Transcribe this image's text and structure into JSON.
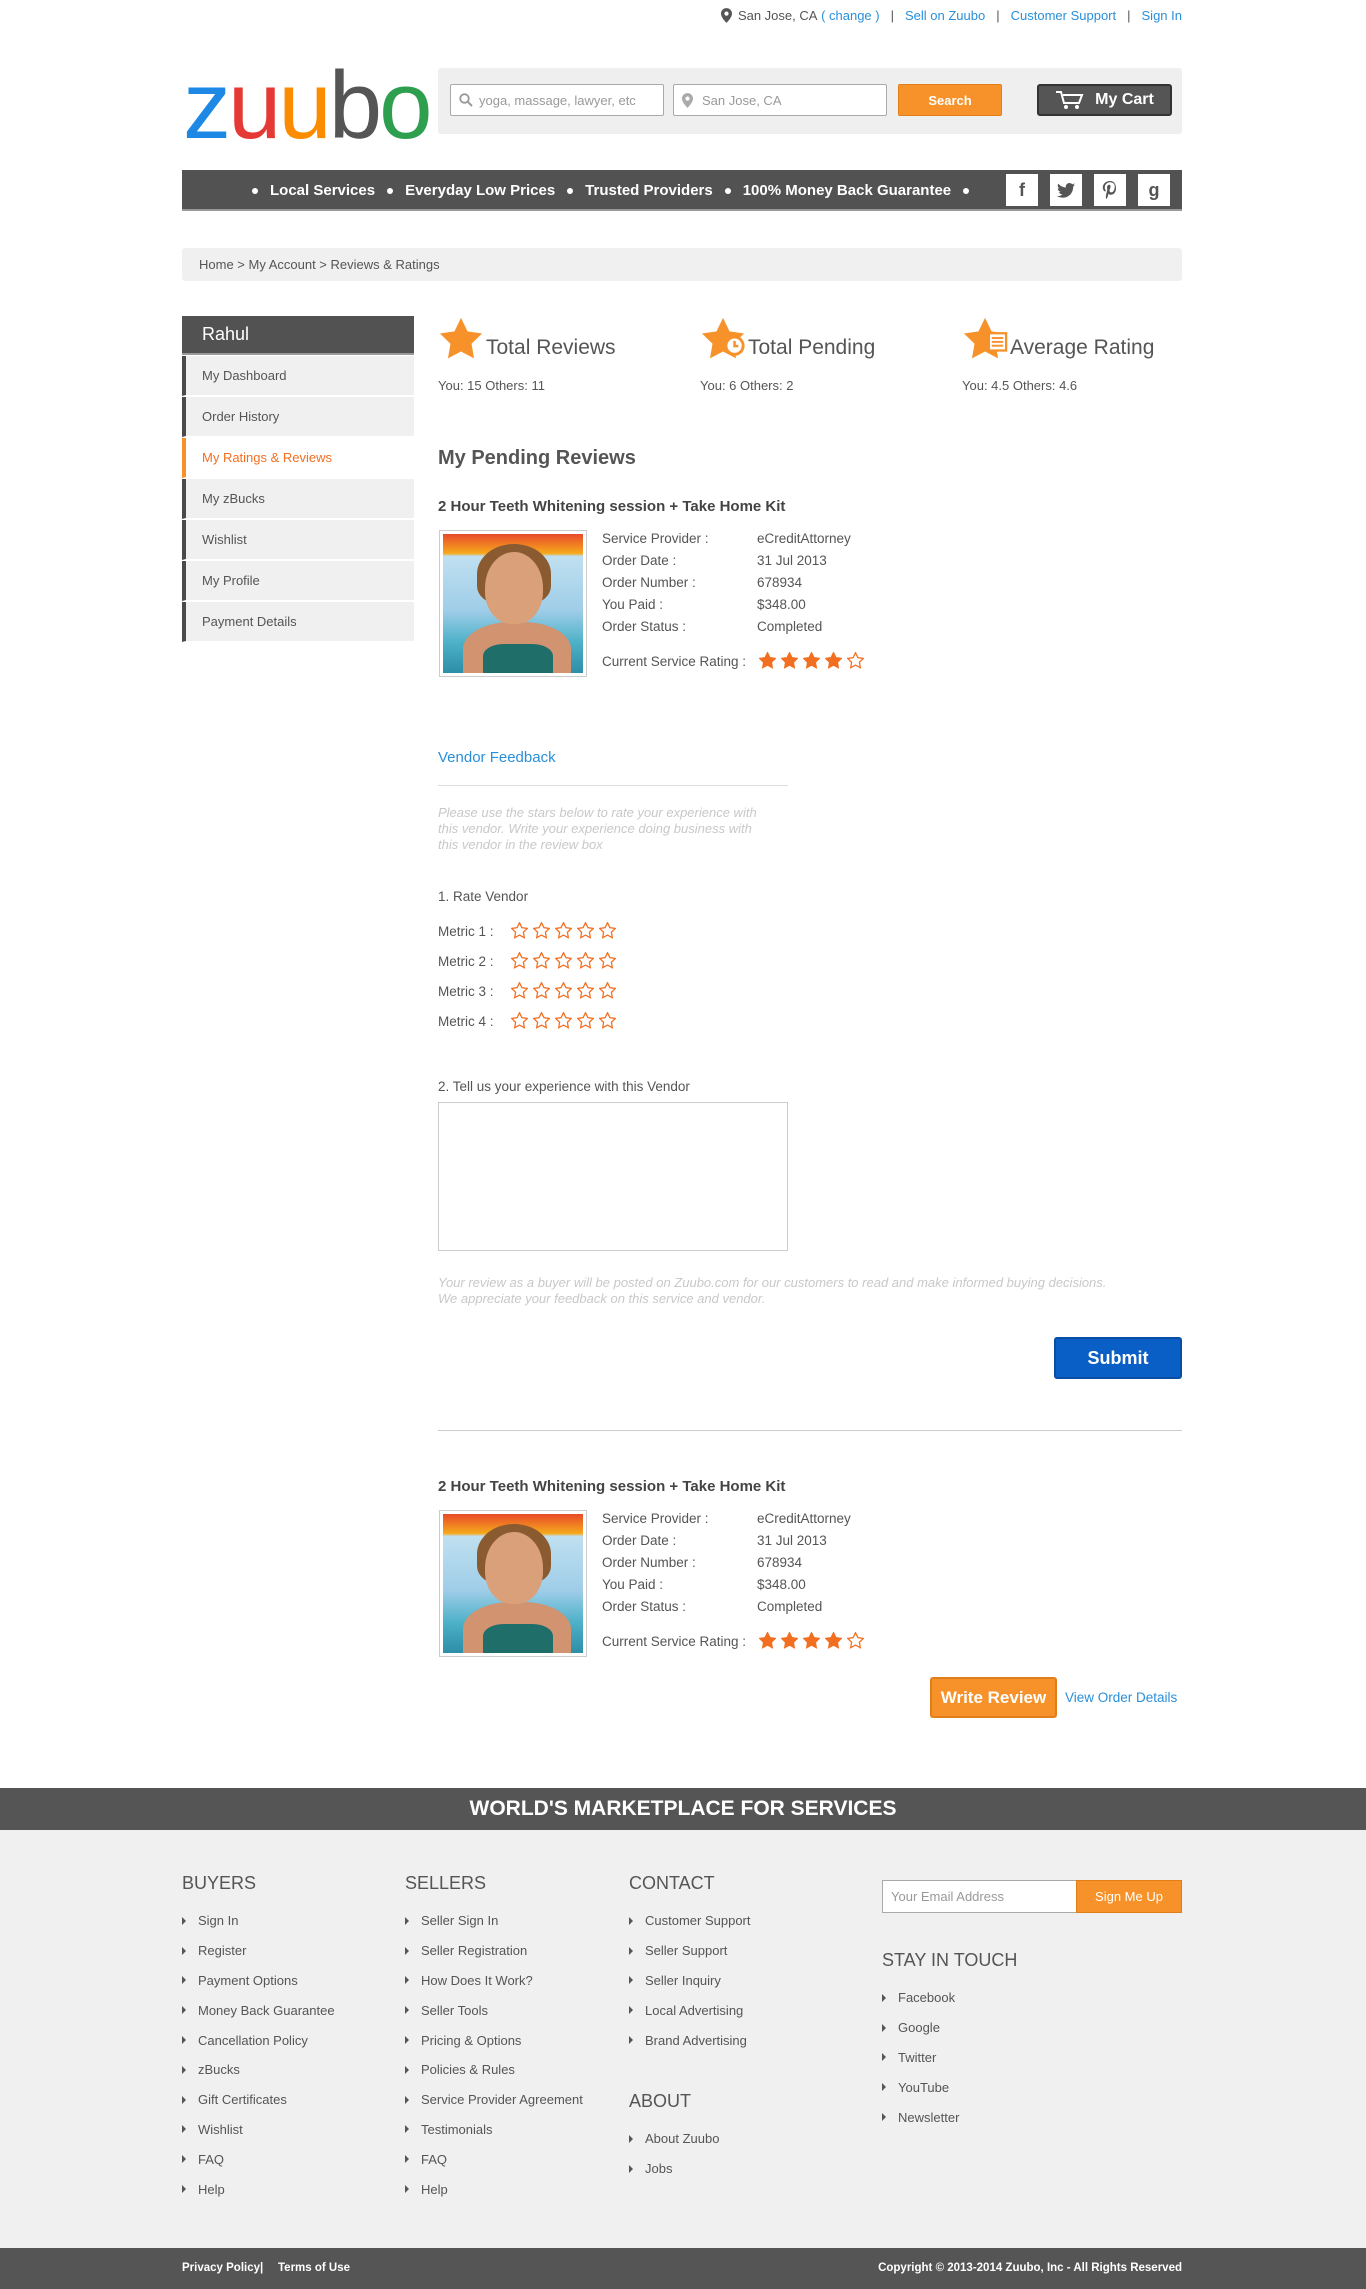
{
  "topbar": {
    "location": "San Jose, CA",
    "change": "( change )",
    "links": [
      "Sell on Zuubo",
      "Customer Support",
      "Sign In"
    ]
  },
  "brand": {
    "logo_letters": [
      "z",
      "u",
      "u",
      "b",
      "o"
    ],
    "logo_colors": [
      "#1e88e5",
      "#e53935",
      "#fb8c00",
      "#555555",
      "#2e9e4f"
    ]
  },
  "search": {
    "query_placeholder": "yoga, massage, lawyer, etc",
    "location_placeholder": "San Jose, CA",
    "search_label": "Search",
    "cart_label": "My Cart"
  },
  "nav": {
    "items": [
      "Local Services",
      "Everyday Low Prices",
      "Trusted Providers",
      "100% Money Back Guarantee"
    ],
    "social": [
      "f",
      "t",
      "p",
      "g"
    ]
  },
  "breadcrumb": "Home  >  My Account > Reviews & Ratings",
  "sidebar": {
    "user": "Rahul",
    "items": [
      "My Dashboard",
      "Order History",
      "My Ratings & Reviews",
      "My zBucks",
      "Wishlist",
      "My Profile",
      "Payment Details"
    ],
    "active_index": 2
  },
  "stats": [
    {
      "title": "Total Reviews",
      "detail": "You: 15   Others: 11"
    },
    {
      "title": "Total Pending",
      "detail": "You: 6   Others: 2"
    },
    {
      "title": "Average Rating",
      "detail": "You: 4.5   Others: 4.6"
    }
  ],
  "pending": {
    "heading": "My Pending Reviews",
    "labels": [
      "Service Provider :",
      "Order Date :",
      "Order Number :",
      "You Paid :",
      "Order Status :"
    ],
    "rating_label": "Current Service Rating :",
    "orders": [
      {
        "title": "2 Hour Teeth Whitening  session + Take Home Kit",
        "values": [
          "eCreditAttorney",
          "31 Jul 2013",
          "678934",
          "$348.00",
          "Completed"
        ],
        "rating": 4
      },
      {
        "title": "2 Hour Teeth Whitening  session + Take Home Kit",
        "values": [
          "eCreditAttorney",
          "31 Jul 2013",
          "678934",
          "$348.00",
          "Completed"
        ],
        "rating": 4
      }
    ]
  },
  "feedback": {
    "title": "Vendor Feedback",
    "hint": [
      "Please use the stars below to rate your experience with",
      "this vendor.  Write your experience doing business with",
      "this vendor in the review box"
    ],
    "rate_label": "1. Rate Vendor",
    "metrics": [
      "Metric 1 :",
      "Metric 2 :",
      "Metric 3 :",
      "Metric 4 :"
    ],
    "experience_label": "2.  Tell us your experience with this Vendor",
    "disclaimer": [
      "Your review as a buyer will be posted on Zuubo.com for our customers to read and make informed buying decisions.",
      "We appreciate your feedback on this service and vendor."
    ],
    "submit": "Submit"
  },
  "actions": {
    "write_review": "Write Review",
    "view_order": "View Order Details"
  },
  "footer": {
    "tagline": "WORLD'S MARKETPLACE FOR SERVICES",
    "buyers": {
      "title": "BUYERS",
      "links": [
        "Sign In",
        "Register",
        "Payment Options",
        "Money Back Guarantee",
        "Cancellation Policy",
        "zBucks",
        "Gift Certificates",
        "Wishlist",
        "FAQ",
        "Help"
      ]
    },
    "sellers": {
      "title": "SELLERS",
      "links": [
        "Seller Sign In",
        "Seller Registration",
        "How Does It Work?",
        "Seller Tools",
        "Pricing & Options",
        "Policies & Rules",
        "Service Provider Agreement",
        "Testimonials",
        "FAQ",
        "Help"
      ]
    },
    "contact": {
      "title": "CONTACT",
      "links": [
        "Customer Support",
        "Seller Support",
        "Seller Inquiry",
        "Local Advertising",
        "Brand Advertising"
      ]
    },
    "about": {
      "title": "ABOUT",
      "links": [
        "About Zuubo",
        "Jobs"
      ]
    },
    "newsletter": {
      "placeholder": "Your Email Address",
      "button": "Sign Me Up"
    },
    "stay": {
      "title": "STAY IN TOUCH",
      "links": [
        "Facebook",
        "Google",
        "Twitter",
        "YouTube",
        "Newsletter"
      ]
    },
    "legal": [
      "Privacy Policy",
      "Terms of Use"
    ],
    "copyright": "Copyright © 2013-2014 Zuubo, Inc - All Rights Reserved"
  },
  "colors": {
    "accent": "#f7922a",
    "star": "#f26f21",
    "link": "#2a8fd9",
    "submit": "#0a5fc7"
  }
}
